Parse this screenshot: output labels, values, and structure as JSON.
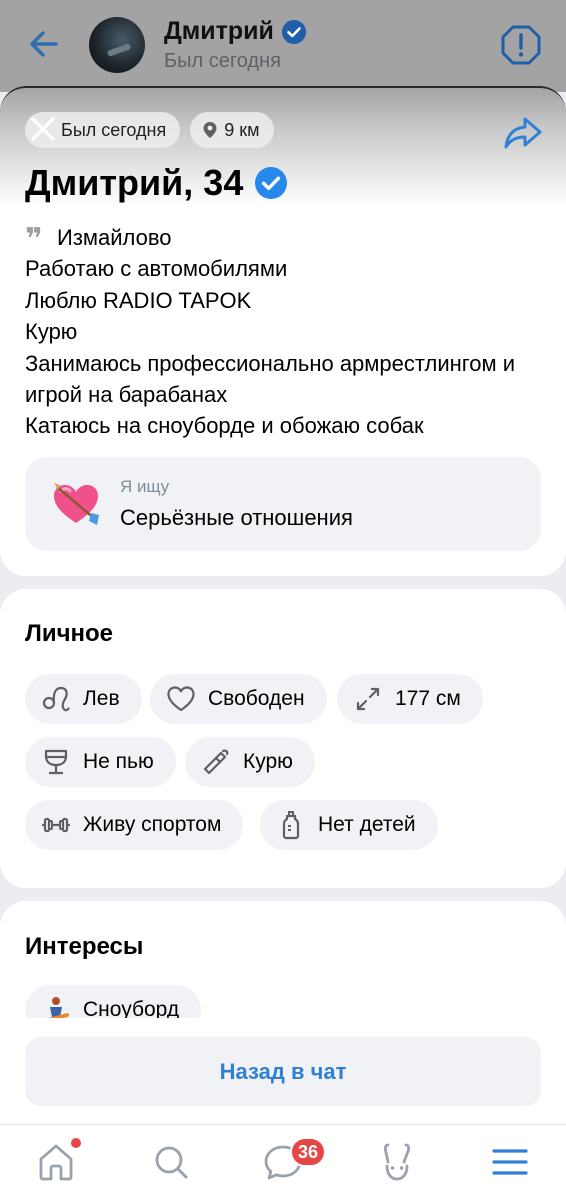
{
  "header": {
    "name": "Дмитрий",
    "status": "Был сегодня"
  },
  "profile": {
    "last_seen": "Был сегодня",
    "distance": "9 км",
    "title": "Дмитрий, 34",
    "bio": [
      "Измайлово",
      "Работаю с автомобилями",
      "Люблю RADIO TAPOK",
      "Курю",
      "Занимаюсь профессионально армрестлингом и игрой на барабанах",
      "Катаюсь на сноуборде и обожаю собак"
    ],
    "seeking": {
      "label": "Я ищу",
      "value": "Серьёзные отношения"
    }
  },
  "personal": {
    "heading": "Личное",
    "tags": [
      {
        "icon": "leo-zodiac-icon",
        "label": "Лев"
      },
      {
        "icon": "heart-outline-icon",
        "label": "Свободен"
      },
      {
        "icon": "height-arrows-icon",
        "label": "177 см"
      },
      {
        "icon": "glass-icon",
        "label": "Не пью"
      },
      {
        "icon": "cigarette-icon",
        "label": "Курю"
      },
      {
        "icon": "dumbbell-icon",
        "label": "Живу спортом"
      },
      {
        "icon": "baby-bottle-icon",
        "label": "Нет детей"
      }
    ]
  },
  "interests": {
    "heading": "Интересы",
    "items": [
      {
        "icon": "snowboarder-icon",
        "label": "Сноуборд"
      }
    ]
  },
  "actions": {
    "back_to_chat": "Назад в чат"
  },
  "nav": {
    "messages_badge": "36"
  },
  "colors": {
    "accent": "#2f80d6",
    "verified": "#2688eb",
    "badge": "#e64646"
  }
}
